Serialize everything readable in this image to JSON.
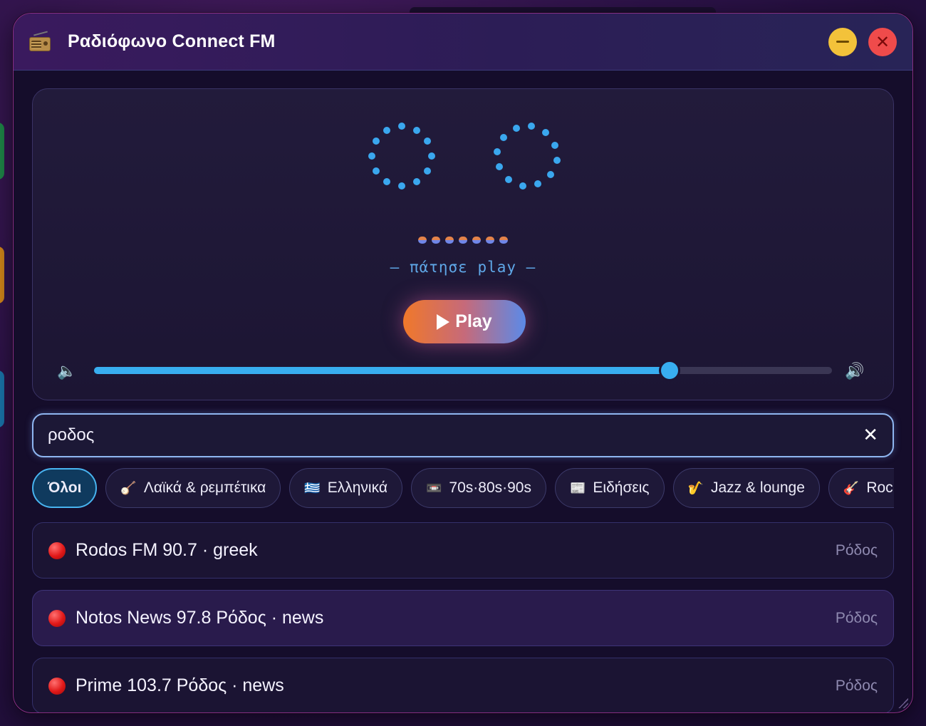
{
  "window": {
    "title": "Ραδιόφωνο Connect FM",
    "minimize_label": "—",
    "close_label": "✕"
  },
  "player": {
    "hint": "— πάτησε play —",
    "play_label": "Play",
    "volume_level": 0.78,
    "accent": "#38aef0",
    "volume_low_icon": "speaker-low-icon",
    "volume_high_icon": "speaker-high-icon"
  },
  "search": {
    "value": "ροδος",
    "clear_label": "✕"
  },
  "filters": [
    {
      "emoji": "",
      "label": "Όλοι",
      "active": true
    },
    {
      "emoji": "🪕",
      "label": "Λαϊκά & ρεμπέτικα",
      "active": false
    },
    {
      "emoji": "🇬🇷",
      "label": "Ελληνικά",
      "active": false
    },
    {
      "emoji": "📼",
      "label": "70s·80s·90s",
      "active": false
    },
    {
      "emoji": "📰",
      "label": "Ειδήσεις",
      "active": false
    },
    {
      "emoji": "🎷",
      "label": "Jazz & lounge",
      "active": false
    },
    {
      "emoji": "🎸",
      "label": "Rock",
      "active": false
    }
  ],
  "stations": [
    {
      "name": "Rodos FM 90.7 · greek",
      "city": "Ρόδος"
    },
    {
      "name": "Notos News 97.8 Ρόδος · news",
      "city": "Ρόδος"
    },
    {
      "name": "Prime 103.7 Ρόδος · news",
      "city": "Ρόδος"
    }
  ]
}
